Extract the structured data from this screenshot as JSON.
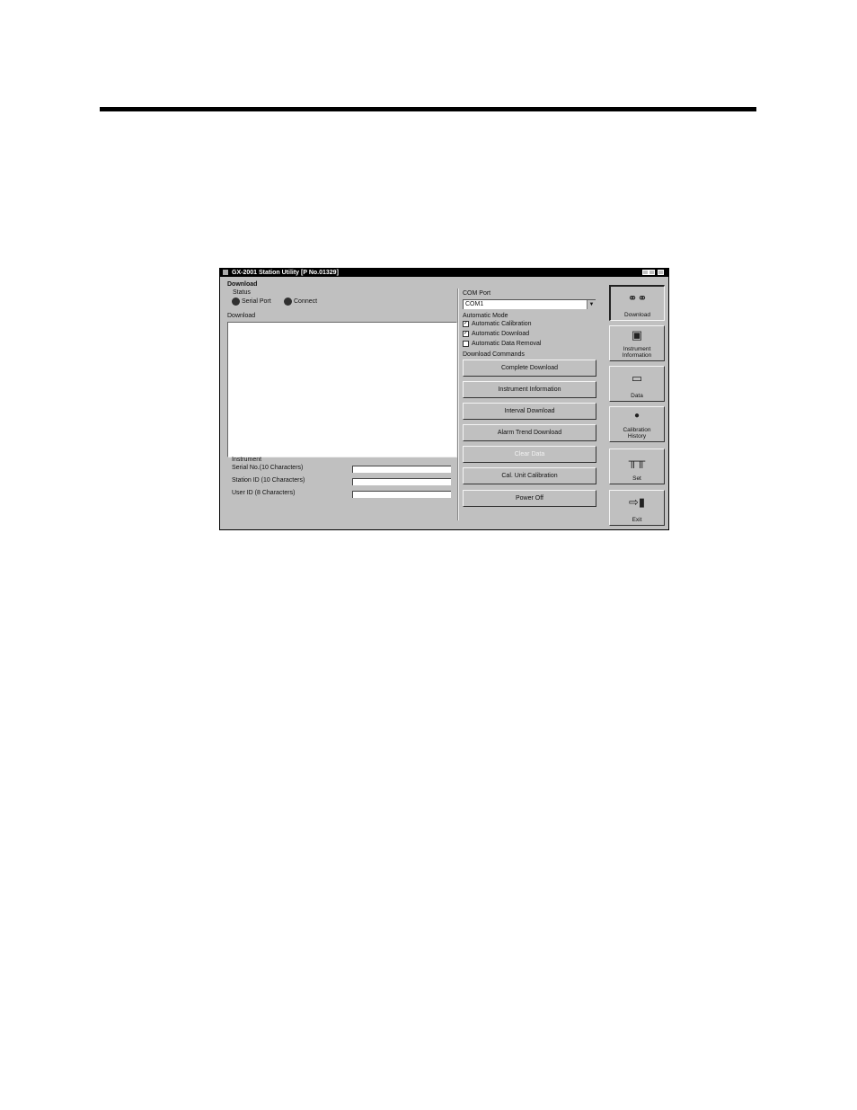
{
  "window": {
    "title": "GX-2001 Station Utility [P No.01329]"
  },
  "download_panel": {
    "heading": "Download",
    "status_label": "Status",
    "serial_port_label": "Serial Port",
    "connect_label": "Connect",
    "download_list_label": "Download"
  },
  "instrument": {
    "section_label": "Instrument",
    "serial_no_label": "Serial No.(10 Characters)",
    "station_id_label": "Station ID (10 Characters)",
    "user_id_label": "User ID (8 Characters)",
    "serial_no_value": "",
    "station_id_value": "",
    "user_id_value": ""
  },
  "com_port": {
    "label": "COM Port",
    "selected": "COM1"
  },
  "automatic_mode": {
    "label": "Automatic Mode",
    "options": [
      {
        "label": "Automatic Calibration",
        "checked": true
      },
      {
        "label": "Automatic Download",
        "checked": true
      },
      {
        "label": "Automatic Data Removal",
        "checked": false
      }
    ]
  },
  "download_commands": {
    "label": "Download Commands",
    "buttons": [
      {
        "label": "Complete Download",
        "enabled": true
      },
      {
        "label": "Instrument Information",
        "enabled": true
      },
      {
        "label": "Interval Download",
        "enabled": true
      },
      {
        "label": "Alarm Trend Download",
        "enabled": true
      },
      {
        "label": "Clear Data",
        "enabled": false
      },
      {
        "label": "Cal. Unit Calibration",
        "enabled": true
      },
      {
        "label": "Power Off",
        "enabled": true
      }
    ]
  },
  "sidebar": {
    "buttons": [
      {
        "label": "Download",
        "icon": "download-icon"
      },
      {
        "label": "Instrument\nInformation",
        "icon": "instrument-icon"
      },
      {
        "label": "Data",
        "icon": "folder-icon"
      },
      {
        "label": "Calibration\nHistory",
        "icon": "calibration-icon"
      },
      {
        "label": "Set",
        "icon": "set-icon"
      },
      {
        "label": "Exit",
        "icon": "exit-icon"
      }
    ]
  }
}
